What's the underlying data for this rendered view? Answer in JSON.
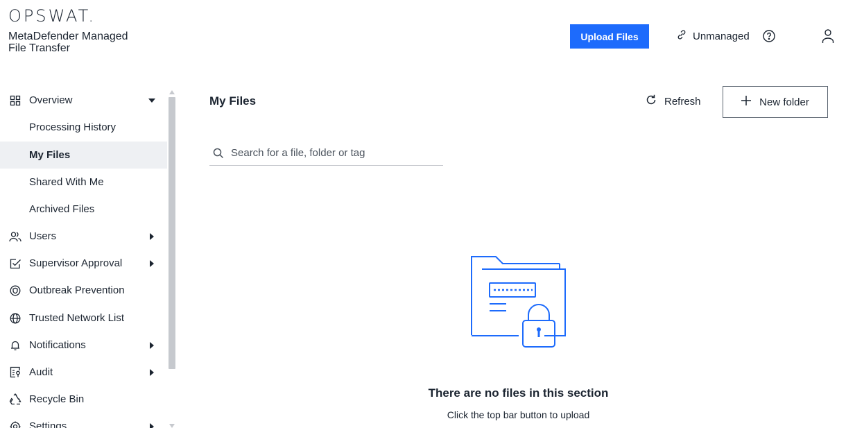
{
  "header": {
    "logo": "OPSWAT.",
    "product_name": "MetaDefender Managed File Transfer",
    "upload_label": "Upload Files",
    "unmanaged_label": "Unmanaged",
    "icons": {
      "unmanaged": "link-broken-icon",
      "help": "help-circle-icon",
      "user": "user-icon"
    },
    "accent_color": "#1d6bfc"
  },
  "sidebar": {
    "items": [
      {
        "label": "Overview",
        "icon": "grid-icon",
        "expandable": true,
        "expanded": true
      },
      {
        "label": "Processing History",
        "sub": true
      },
      {
        "label": "My Files",
        "sub": true,
        "active": true
      },
      {
        "label": "Shared With Me",
        "sub": true
      },
      {
        "label": "Archived Files",
        "sub": true
      },
      {
        "label": "Users",
        "icon": "users-icon",
        "expandable": true
      },
      {
        "label": "Supervisor Approval",
        "icon": "approval-icon",
        "expandable": true
      },
      {
        "label": "Outbreak Prevention",
        "icon": "shield-icon"
      },
      {
        "label": "Trusted Network List",
        "icon": "globe-icon"
      },
      {
        "label": "Notifications",
        "icon": "bell-icon",
        "expandable": true
      },
      {
        "label": "Audit",
        "icon": "audit-icon",
        "expandable": true
      },
      {
        "label": "Recycle Bin",
        "icon": "recycle-icon"
      },
      {
        "label": "Settings",
        "icon": "gear-icon",
        "expandable": true
      }
    ]
  },
  "main": {
    "title": "My Files",
    "refresh_label": "Refresh",
    "new_folder_label": "New folder",
    "search_placeholder": "Search for a file, folder or tag",
    "empty_title": "There are no files in this section",
    "empty_subtitle": "Click the top bar button to upload"
  }
}
